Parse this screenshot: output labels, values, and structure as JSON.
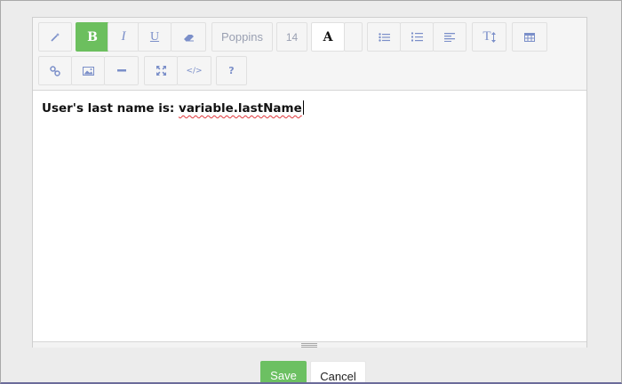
{
  "toolbar": {
    "magic_icon": "magic-wand-icon",
    "bold_label": "B",
    "italic_label": "I",
    "underline_label": "U",
    "eraser_icon": "eraser-icon",
    "font_family": "Poppins",
    "font_size": "14",
    "font_color_label": "A",
    "ul_icon": "unordered-list-icon",
    "ol_icon": "ordered-list-icon",
    "align_icon": "align-left-icon",
    "line_height_label": "T",
    "table_icon": "table-icon",
    "link_icon": "link-icon",
    "picture_icon": "picture-icon",
    "hr_icon": "horizontal-rule-icon",
    "fullscreen_icon": "fullscreen-icon",
    "codeview_label": "</>",
    "help_label": "?",
    "active_color": "#6cbf5e",
    "icon_color": "#7b8fc9"
  },
  "editor": {
    "text_prefix": "User's last name is: ",
    "text_variable": "variable.lastName"
  },
  "actions": {
    "save_label": "Save",
    "cancel_label": "Cancel",
    "save_color": "#6cc062"
  }
}
